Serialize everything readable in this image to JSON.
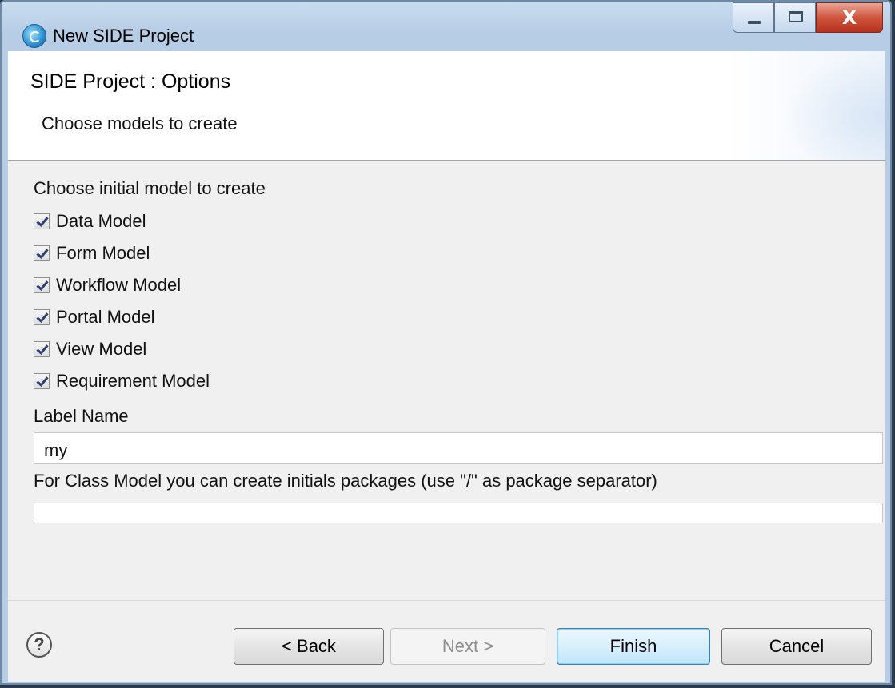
{
  "window": {
    "title": "New SIDE Project"
  },
  "banner": {
    "title": "SIDE Project : Options",
    "description": "Choose models to create"
  },
  "models": {
    "section_label": "Choose initial model to create",
    "items": [
      {
        "label": "Data Model",
        "checked": true
      },
      {
        "label": "Form Model",
        "checked": true
      },
      {
        "label": "Workflow Model",
        "checked": true
      },
      {
        "label": "Portal Model",
        "checked": true
      },
      {
        "label": "View Model",
        "checked": true
      },
      {
        "label": "Requirement Model",
        "checked": true
      }
    ]
  },
  "label_name": {
    "label": "Label Name",
    "value": "my"
  },
  "packages": {
    "label": "For Class Model you can create initials packages (use \"/\" as package separator)",
    "value": ""
  },
  "buttons": {
    "help": "?",
    "back": "< Back",
    "next": "Next >",
    "finish": "Finish",
    "cancel": "Cancel"
  },
  "controls": {
    "close": "X"
  }
}
